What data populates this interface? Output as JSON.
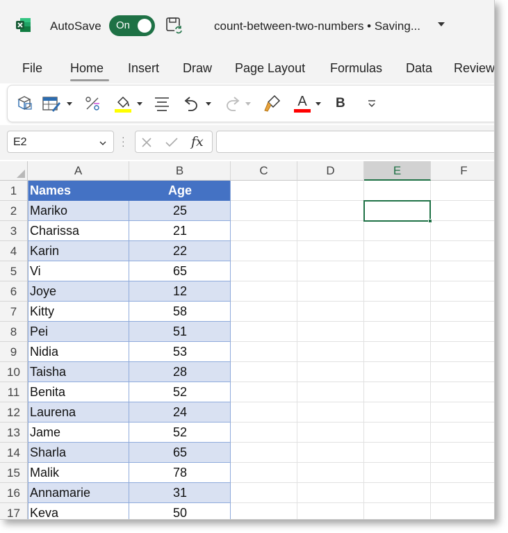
{
  "titlebar": {
    "autosave_label": "AutoSave",
    "autosave_state": "On",
    "document_title": "count-between-two-numbers • Saving..."
  },
  "menu": {
    "tabs": [
      "File",
      "Home",
      "Insert",
      "Draw",
      "Page Layout",
      "Formulas",
      "Data",
      "Review"
    ],
    "active_tab": "Home"
  },
  "toolbar": {
    "icons": [
      "clipboard-icon",
      "table-format-icon",
      "percent-icon",
      "fill-color-icon",
      "align-icon",
      "undo-icon",
      "redo-icon",
      "format-painter-icon",
      "font-color-icon",
      "bold-icon",
      "more-icon"
    ],
    "font_color_letter": "A",
    "bold_letter": "B",
    "fill_color": "#ffff00",
    "font_color": "#ff0000"
  },
  "formula_bar": {
    "name_box": "E2",
    "fx_label": "fx",
    "formula": ""
  },
  "grid": {
    "columns": [
      "A",
      "B",
      "C",
      "D",
      "E",
      "F"
    ],
    "selected_column": "E",
    "rows": [
      "1",
      "2",
      "3",
      "4",
      "5",
      "6",
      "7",
      "8",
      "9",
      "10",
      "11",
      "12",
      "13",
      "14",
      "15",
      "16",
      "17"
    ]
  },
  "table": {
    "headers": [
      "Names",
      "Age"
    ],
    "rows": [
      {
        "name": "Mariko",
        "age": "25"
      },
      {
        "name": "Charissa",
        "age": "21"
      },
      {
        "name": "Karin",
        "age": "22"
      },
      {
        "name": "Vi",
        "age": "65"
      },
      {
        "name": "Joye",
        "age": "12"
      },
      {
        "name": "Kitty",
        "age": "58"
      },
      {
        "name": "Pei",
        "age": "51"
      },
      {
        "name": "Nidia",
        "age": "53"
      },
      {
        "name": "Taisha",
        "age": "28"
      },
      {
        "name": "Benita",
        "age": "52"
      },
      {
        "name": "Laurena",
        "age": "24"
      },
      {
        "name": "Jame",
        "age": "52"
      },
      {
        "name": "Sharla",
        "age": "65"
      },
      {
        "name": "Malik",
        "age": "78"
      },
      {
        "name": "Annamarie",
        "age": "31"
      },
      {
        "name": "Keva",
        "age": "50"
      }
    ],
    "header_color": "#4472c4",
    "band_color": "#d9e1f2"
  },
  "colors": {
    "excel_green": "#1e7145",
    "chrome_bg": "#f3f3f3"
  }
}
